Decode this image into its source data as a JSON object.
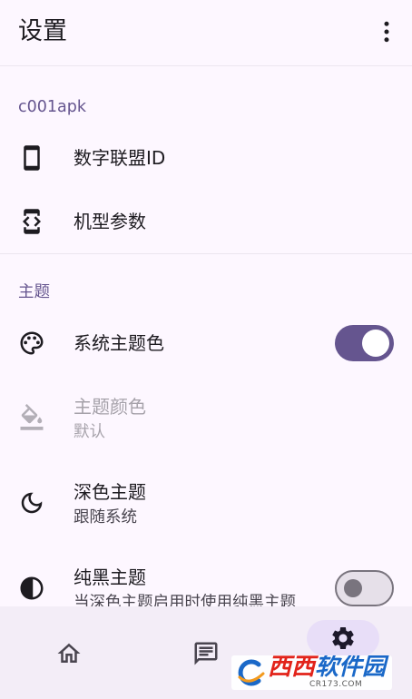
{
  "app_bar": {
    "title": "设置",
    "more_icon": "more-vert-icon"
  },
  "sections": [
    {
      "header": "c001apk",
      "items": [
        {
          "icon": "smartphone-icon",
          "title": "数字联盟ID"
        },
        {
          "icon": "developer-mode-icon",
          "title": "机型参数"
        }
      ]
    },
    {
      "header": "主题",
      "items": [
        {
          "icon": "palette-icon",
          "title": "系统主题色",
          "switch_on": true
        },
        {
          "icon": "format-color-fill-icon",
          "title": "主题颜色",
          "subtitle": "默认",
          "disabled": true
        },
        {
          "icon": "dark-mode-icon",
          "title": "深色主题",
          "subtitle": "跟随系统"
        },
        {
          "icon": "contrast-icon",
          "title": "纯黑主题",
          "subtitle": "当深色主题启用时使用纯黑主题",
          "switch_on": false
        }
      ]
    }
  ],
  "bottom_nav": {
    "items": [
      {
        "icon": "home-icon",
        "selected": false
      },
      {
        "icon": "message-icon",
        "selected": false
      },
      {
        "icon": "settings-icon",
        "selected": true
      }
    ]
  },
  "watermark": {
    "brand_part1": "西西",
    "brand_part2": "软件园",
    "site": "CR173.COM",
    "logo_icon": "cr173-logo-icon"
  },
  "colors": {
    "background": "#fdf7ff",
    "primary": "#65558f",
    "on_surface": "#1d1b20",
    "on_surface_variant": "#49454f",
    "disabled": "#a6a2aa",
    "nav_background": "#f3edf7",
    "nav_indicator": "#e8def8",
    "switch_off_outline": "#79747e"
  }
}
